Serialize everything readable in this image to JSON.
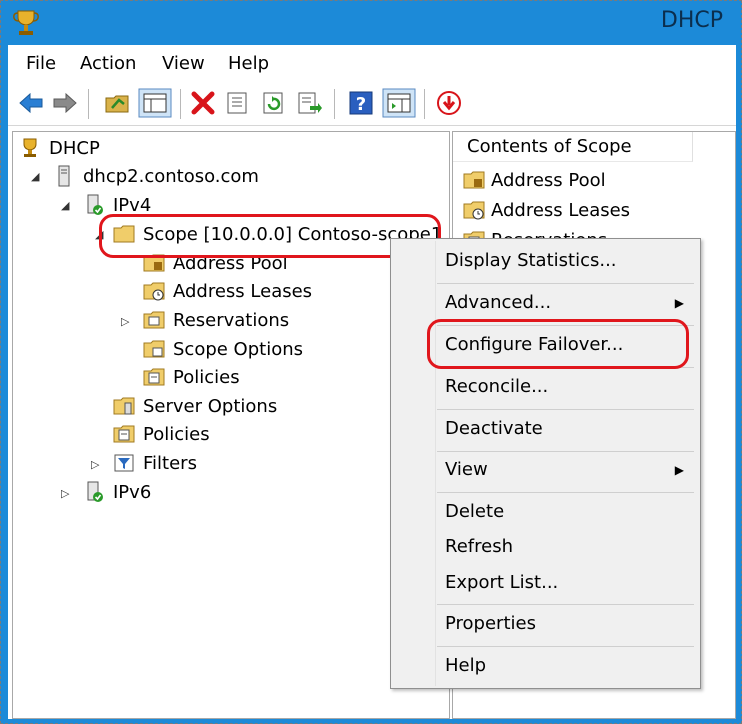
{
  "window": {
    "title": "DHCP"
  },
  "menubar": {
    "items": [
      "File",
      "Action",
      "View",
      "Help"
    ]
  },
  "toolbar": {
    "icons": [
      "back-icon",
      "forward-icon",
      "up-folder-icon",
      "show-hide-tree-icon",
      "delete-icon",
      "properties-icon",
      "refresh-icon",
      "export-list-icon",
      "help-icon",
      "show-hide-action-pane-icon",
      "deactivate-icon"
    ]
  },
  "tree": {
    "root": "DHCP",
    "server": "dhcp2.contoso.com",
    "ipv4": "IPv4",
    "scope": "Scope [10.0.0.0] Contoso-scope1",
    "scope_children": [
      "Address Pool",
      "Address Leases",
      "Reservations",
      "Scope Options",
      "Policies"
    ],
    "server_options": "Server Options",
    "policies": "Policies",
    "filters": "Filters",
    "ipv6": "IPv6"
  },
  "content": {
    "header": "Contents of Scope",
    "rows": [
      "Address Pool",
      "Address Leases",
      "Reservations"
    ]
  },
  "context_menu": {
    "items": [
      {
        "label": "Display Statistics...",
        "submenu": false
      },
      {
        "label": "Advanced...",
        "submenu": true
      },
      {
        "label": "Configure Failover...",
        "submenu": false
      },
      {
        "label": "Reconcile...",
        "submenu": false
      },
      {
        "label": "Deactivate",
        "submenu": false
      },
      {
        "label": "View",
        "submenu": true
      },
      {
        "label": "Delete",
        "submenu": false
      },
      {
        "label": "Refresh",
        "submenu": false
      },
      {
        "label": "Export List...",
        "submenu": false
      },
      {
        "label": "Properties",
        "submenu": false
      },
      {
        "label": "Help",
        "submenu": false
      }
    ]
  },
  "colors": {
    "titlebar": "#1c8ad8",
    "highlight": "#e0161c",
    "menu_bg": "#f0f0f0"
  }
}
